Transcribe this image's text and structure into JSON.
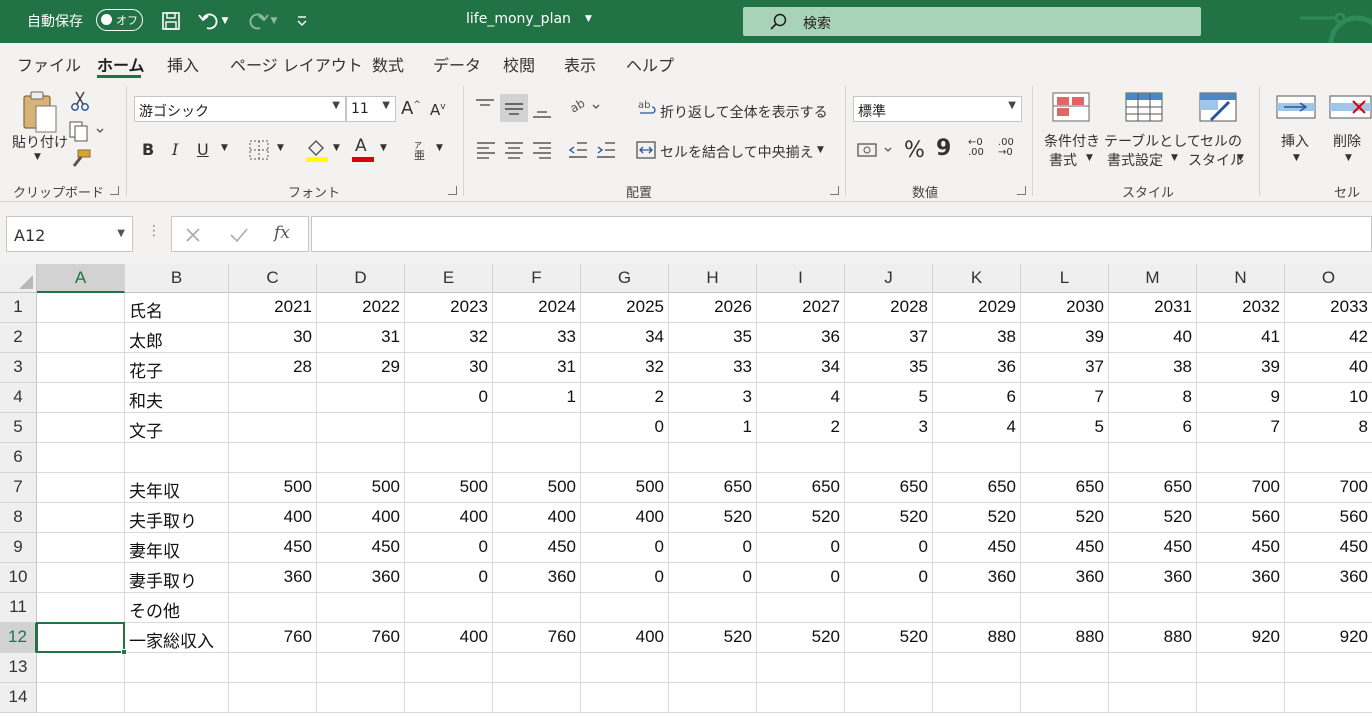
{
  "titlebar": {
    "autosave_label": "自動保存",
    "autosave_state": "オフ",
    "filename": "life_mony_plan",
    "search_placeholder": "検索"
  },
  "tabs": [
    {
      "label": "ファイル"
    },
    {
      "label": "ホーム"
    },
    {
      "label": "挿入"
    },
    {
      "label": "ページ レイアウト"
    },
    {
      "label": "数式"
    },
    {
      "label": "データ"
    },
    {
      "label": "校閲"
    },
    {
      "label": "表示"
    },
    {
      "label": "ヘルプ"
    }
  ],
  "ribbon": {
    "clipboard": {
      "paste_label": "貼り付け",
      "group_label": "クリップボード"
    },
    "font": {
      "font_name": "游ゴシック",
      "font_size": "11",
      "group_label": "フォント",
      "bold": "B",
      "italic": "I",
      "underline": "U",
      "font_color_glyph": "A",
      "phonetic_glyph": "亜"
    },
    "alignment": {
      "wrap_text": "折り返して全体を表示する",
      "merge_center": "セルを結合して中央揃え",
      "group_label": "配置"
    },
    "number": {
      "format": "標準",
      "group_label": "数値",
      "percent": "%",
      "comma": "9"
    },
    "styles": {
      "conditional_line1": "条件付き",
      "conditional_line2": "書式",
      "table_line1": "テーブルとして",
      "table_line2": "書式設定",
      "cell_line1": "セルの",
      "cell_line2": "スタイル",
      "group_label": "スタイル"
    },
    "cells": {
      "insert": "挿入",
      "delete": "削除",
      "group_label": "セル"
    }
  },
  "formula_bar": {
    "name_box": "A12",
    "fx": "fx",
    "formula": ""
  },
  "sheet": {
    "columns": [
      "A",
      "B",
      "C",
      "D",
      "E",
      "F",
      "G",
      "H",
      "I",
      "J",
      "K",
      "L",
      "M",
      "N",
      "O"
    ],
    "selected_column": "A",
    "selected_row": 12,
    "rows": [
      {
        "n": "1",
        "cells": [
          "",
          "氏名",
          "2021",
          "2022",
          "2023",
          "2024",
          "2025",
          "2026",
          "2027",
          "2028",
          "2029",
          "2030",
          "2031",
          "2032",
          "2033"
        ]
      },
      {
        "n": "2",
        "cells": [
          "",
          "太郎",
          "30",
          "31",
          "32",
          "33",
          "34",
          "35",
          "36",
          "37",
          "38",
          "39",
          "40",
          "41",
          "42"
        ]
      },
      {
        "n": "3",
        "cells": [
          "",
          "花子",
          "28",
          "29",
          "30",
          "31",
          "32",
          "33",
          "34",
          "35",
          "36",
          "37",
          "38",
          "39",
          "40"
        ]
      },
      {
        "n": "4",
        "cells": [
          "",
          "和夫",
          "",
          "",
          "0",
          "1",
          "2",
          "3",
          "4",
          "5",
          "6",
          "7",
          "8",
          "9",
          "10"
        ]
      },
      {
        "n": "5",
        "cells": [
          "",
          "文子",
          "",
          "",
          "",
          "",
          "0",
          "1",
          "2",
          "3",
          "4",
          "5",
          "6",
          "7",
          "8"
        ]
      },
      {
        "n": "6",
        "cells": [
          "",
          "",
          "",
          "",
          "",
          "",
          "",
          "",
          "",
          "",
          "",
          "",
          "",
          "",
          ""
        ]
      },
      {
        "n": "7",
        "cells": [
          "",
          "夫年収",
          "500",
          "500",
          "500",
          "500",
          "500",
          "650",
          "650",
          "650",
          "650",
          "650",
          "650",
          "700",
          "700"
        ]
      },
      {
        "n": "8",
        "cells": [
          "",
          "夫手取り",
          "400",
          "400",
          "400",
          "400",
          "400",
          "520",
          "520",
          "520",
          "520",
          "520",
          "520",
          "560",
          "560"
        ]
      },
      {
        "n": "9",
        "cells": [
          "",
          "妻年収",
          "450",
          "450",
          "0",
          "450",
          "0",
          "0",
          "0",
          "0",
          "450",
          "450",
          "450",
          "450",
          "450"
        ]
      },
      {
        "n": "10",
        "cells": [
          "",
          "妻手取り",
          "360",
          "360",
          "0",
          "360",
          "0",
          "0",
          "0",
          "0",
          "360",
          "360",
          "360",
          "360",
          "360"
        ]
      },
      {
        "n": "11",
        "cells": [
          "",
          "その他",
          "",
          "",
          "",
          "",
          "",
          "",
          "",
          "",
          "",
          "",
          "",
          "",
          ""
        ]
      },
      {
        "n": "12",
        "cells": [
          "",
          "一家総収入",
          "760",
          "760",
          "400",
          "760",
          "400",
          "520",
          "520",
          "520",
          "880",
          "880",
          "880",
          "920",
          "920"
        ]
      },
      {
        "n": "13",
        "cells": [
          "",
          "",
          "",
          "",
          "",
          "",
          "",
          "",
          "",
          "",
          "",
          "",
          "",
          "",
          ""
        ]
      },
      {
        "n": "14",
        "cells": [
          "",
          "",
          "",
          "",
          "",
          "",
          "",
          "",
          "",
          "",
          "",
          "",
          "",
          "",
          ""
        ]
      }
    ]
  },
  "colors": {
    "accent": "#217346",
    "ribbon_bg": "#f3f2f1"
  }
}
